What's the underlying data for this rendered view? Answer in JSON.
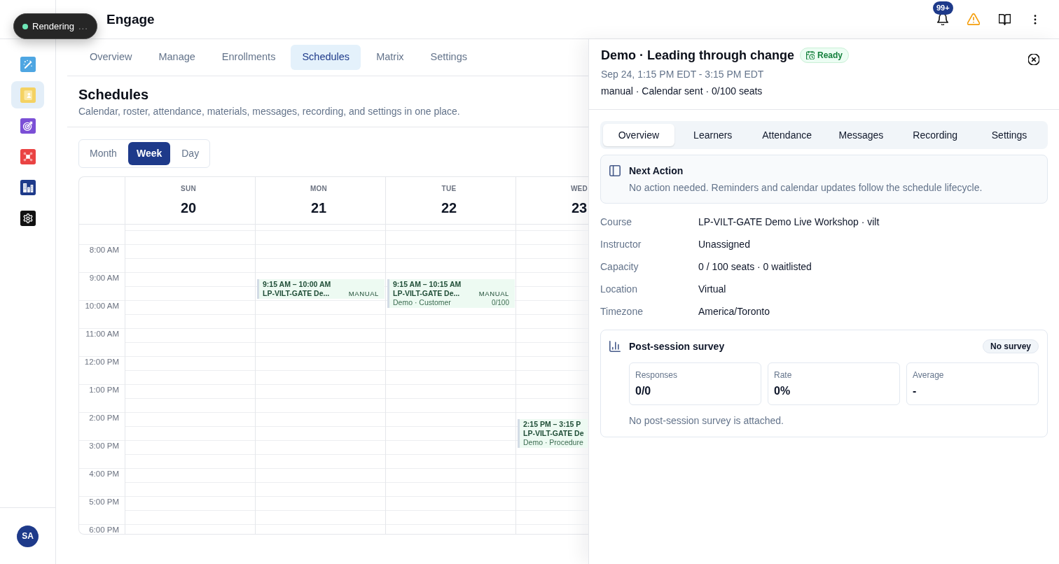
{
  "toast": {
    "label": "Rendering",
    "dots": "..."
  },
  "header": {
    "title": "Engage",
    "notification_count": "99+"
  },
  "sidebar": {
    "items": [
      {
        "selected": false
      },
      {
        "selected": true
      },
      {
        "selected": false
      },
      {
        "selected": false
      },
      {
        "selected": false
      },
      {
        "selected": false
      }
    ],
    "avatar": "SA"
  },
  "tabs": [
    {
      "label": "Overview",
      "selected": false
    },
    {
      "label": "Manage",
      "selected": false
    },
    {
      "label": "Enrollments",
      "selected": false
    },
    {
      "label": "Schedules",
      "selected": true
    },
    {
      "label": "Matrix",
      "selected": false
    },
    {
      "label": "Settings",
      "selected": false
    }
  ],
  "page": {
    "title": "Schedules",
    "subtitle": "Calendar, roster, attendance, materials, messages, recording, and settings in one place."
  },
  "view_toggle": [
    {
      "label": "Month",
      "selected": false
    },
    {
      "label": "Week",
      "selected": true
    },
    {
      "label": "Day",
      "selected": false
    }
  ],
  "calendar": {
    "days": [
      {
        "weekday": "SUN",
        "date": "20"
      },
      {
        "weekday": "MON",
        "date": "21",
        "events": [
          {
            "time": "9:15 AM – 10:00 AM",
            "title": "LP-VILT-GATE De...",
            "mode": "MANUAL"
          }
        ]
      },
      {
        "weekday": "TUE",
        "date": "22",
        "events": [
          {
            "time": "9:15 AM – 10:15 AM",
            "title": "LP-VILT-GATE De...",
            "mode": "MANUAL",
            "subtitle": "Demo · Customer",
            "seats": "0/100"
          }
        ]
      },
      {
        "weekday": "WED",
        "date": "23",
        "events": [
          {
            "time": "2:15 PM – 3:15 P",
            "title": "LP-VILT-GATE De",
            "subtitle": "Demo · Procedure"
          }
        ]
      }
    ],
    "times": [
      "8:00 AM",
      "9:00 AM",
      "10:00 AM",
      "11:00 AM",
      "12:00 PM",
      "1:00 PM",
      "2:00 PM",
      "3:00 PM",
      "4:00 PM",
      "5:00 PM",
      "6:00 PM"
    ]
  },
  "detail_panel": {
    "title": "Demo · Leading through change",
    "status": "Ready",
    "when": "Sep 24, 1:15 PM EDT - 3:15 PM EDT",
    "summary": "manual · Calendar sent · 0/100 seats",
    "tabs": [
      {
        "label": "Overview",
        "selected": true
      },
      {
        "label": "Learners",
        "selected": false
      },
      {
        "label": "Attendance",
        "selected": false
      },
      {
        "label": "Messages",
        "selected": false
      },
      {
        "label": "Recording",
        "selected": false
      },
      {
        "label": "Settings",
        "selected": false
      }
    ],
    "next_action": {
      "title": "Next Action",
      "text": "No action needed. Reminders and calendar updates follow the schedule lifecycle."
    },
    "details": [
      {
        "label": "Course",
        "value": "LP-VILT-GATE Demo Live Workshop · vilt"
      },
      {
        "label": "Instructor",
        "value": "Unassigned"
      },
      {
        "label": "Capacity",
        "value": "0 / 100 seats · 0 waitlisted"
      },
      {
        "label": "Location",
        "value": "Virtual"
      },
      {
        "label": "Timezone",
        "value": "America/Toronto"
      }
    ],
    "survey": {
      "title": "Post-session survey",
      "status": "No survey",
      "stats": [
        {
          "label": "Responses",
          "value": "0/0"
        },
        {
          "label": "Rate",
          "value": "0%"
        },
        {
          "label": "Average",
          "value": "-"
        }
      ],
      "note": "No post-session survey is attached."
    }
  }
}
